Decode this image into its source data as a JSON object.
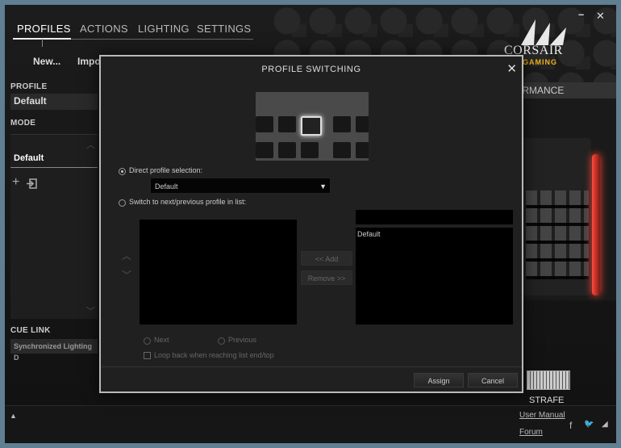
{
  "nav": {
    "tabs": [
      "PROFILES",
      "ACTIONS",
      "LIGHTING",
      "SETTINGS"
    ],
    "active_tab": "PROFILES"
  },
  "toolbar": {
    "new_label": "New...",
    "import_label": "Impo"
  },
  "window_controls": {
    "minimize": "–",
    "close": "✕"
  },
  "brand": {
    "name": "CORSAIR",
    "tagline": "GAMING",
    "accent": "#f0b31b"
  },
  "sidebar": {
    "profile_label": "PROFILE",
    "profile_value": "Default",
    "mode_label": "MODE",
    "mode_item": "Default",
    "add_icon": "+",
    "cue_link_label": "CUE LINK",
    "cue_link_value": "Synchronized Lighting D"
  },
  "right_panel": {
    "header": "ORMANCE",
    "device_name": "STRAFE",
    "keyboard_glow": "#ff4433"
  },
  "footer": {
    "user_manual": "User Manual",
    "forum": "Forum",
    "up_arrow": "▲",
    "social": [
      "f",
      "🐦",
      "◢"
    ]
  },
  "dialog": {
    "title": "PROFILE SWITCHING",
    "close": "✕",
    "direct_label": "Direct profile selection:",
    "direct_value": "Default",
    "switch_label": "Switch to next/previous profile in list:",
    "add_btn": "<< Add",
    "remove_btn": "Remove >>",
    "available_item": "Default",
    "next_label": "Next",
    "previous_label": "Previous",
    "loop_label": "Loop back when reaching list end/top",
    "assign_btn": "Assign",
    "cancel_btn": "Cancel",
    "selected_mode": "direct"
  }
}
